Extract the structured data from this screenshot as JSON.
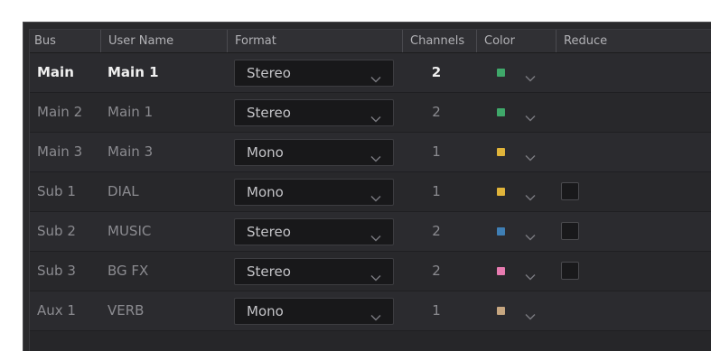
{
  "columns": {
    "bus": "Bus",
    "user_name": "User Name",
    "format": "Format",
    "channels": "Channels",
    "color": "Color",
    "reduce": "Reduce"
  },
  "rows": [
    {
      "bus": "Main",
      "user_name": "Main 1",
      "format": "Stereo",
      "channels": "2",
      "color": "#3fa86a",
      "reduce": false,
      "active": true
    },
    {
      "bus": "Main 2",
      "user_name": "Main 1",
      "format": "Stereo",
      "channels": "2",
      "color": "#3fa86a",
      "reduce": false,
      "active": false
    },
    {
      "bus": "Main 3",
      "user_name": "Main 3",
      "format": "Mono",
      "channels": "1",
      "color": "#e0b43a",
      "reduce": false,
      "active": false
    },
    {
      "bus": "Sub 1",
      "user_name": "DIAL",
      "format": "Mono",
      "channels": "1",
      "color": "#e0b43a",
      "reduce": true,
      "active": false
    },
    {
      "bus": "Sub 2",
      "user_name": "MUSIC",
      "format": "Stereo",
      "channels": "2",
      "color": "#3f7fb5",
      "reduce": true,
      "active": false
    },
    {
      "bus": "Sub 3",
      "user_name": "BG FX",
      "format": "Stereo",
      "channels": "2",
      "color": "#e77bb0",
      "reduce": true,
      "active": false
    },
    {
      "bus": "Aux 1",
      "user_name": "VERB",
      "format": "Mono",
      "channels": "1",
      "color": "#c6a680",
      "reduce": false,
      "active": false
    }
  ],
  "icons": {
    "dropdown": "chevron-down-icon"
  }
}
